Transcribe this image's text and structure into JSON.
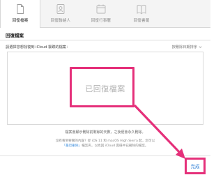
{
  "tabs": [
    {
      "label": "回復檔案",
      "icon": "file-icon",
      "active": true
    },
    {
      "label": "回復聯絡人",
      "icon": "contacts-icon",
      "active": false
    },
    {
      "label": "回復行事曆",
      "icon": "calendar-icon",
      "active": false
    },
    {
      "label": "回復書籤",
      "icon": "bookmark-icon",
      "active": false
    }
  ],
  "section": {
    "title": "回復檔案",
    "instruction": "請選擇您想找復到 iCloud 雲碟的檔案：",
    "sort_label": "按刪除日期排序",
    "empty_label": "已回復檔案"
  },
  "footer": {
    "note": "檔案會顯示刪除前剩餘的天數，之後便會永久刪除。",
    "fine_print_line1": "沒有看到要關的內容？從 iOS 11 和 macOS High Sierra 起，您可以",
    "fine_print_line2_link": "「最近刪除」",
    "fine_print_line2_rest": "檔案夾，以找回 iCloud 雲碟中已刪除的檔案。"
  },
  "done_label": "完成",
  "colors": {
    "highlight": "#e5307a",
    "link": "#2f7fd6"
  }
}
